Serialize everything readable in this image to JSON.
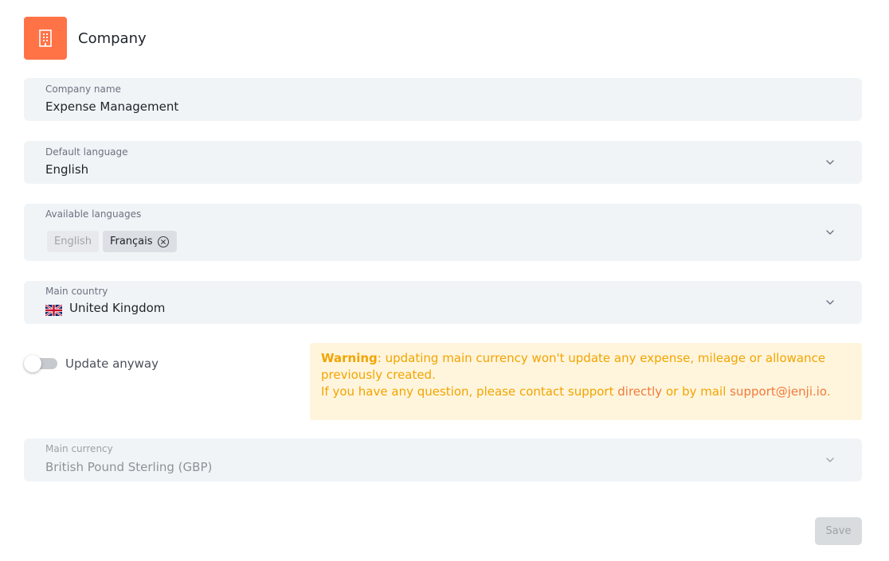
{
  "header": {
    "title": "Company",
    "icon": "building-icon",
    "icon_color": "#ff7347"
  },
  "company_name": {
    "label": "Company name",
    "value": "Expense Management"
  },
  "default_language": {
    "label": "Default language",
    "value": "English"
  },
  "available_languages": {
    "label": "Available languages",
    "chips": [
      {
        "label": "English",
        "removable": false
      },
      {
        "label": "Français",
        "removable": true
      }
    ]
  },
  "main_country": {
    "label": "Main country",
    "value": "United Kingdom",
    "flag": "uk-flag-icon"
  },
  "update_toggle": {
    "label": "Update anyway",
    "checked": false
  },
  "warning": {
    "bold": "Warning",
    "line1": ": updating main currency won't update any expense, mileage or allowance previously created.",
    "line2_prefix": "If you have any question, please contact support ",
    "link1": "directly",
    "line2_middle": " or by mail ",
    "link2": "support@jenji.io",
    "line2_suffix": "."
  },
  "main_currency": {
    "label": "Main currency",
    "value": "British Pound Sterling (GBP)",
    "disabled": true
  },
  "save": {
    "label": "Save"
  }
}
